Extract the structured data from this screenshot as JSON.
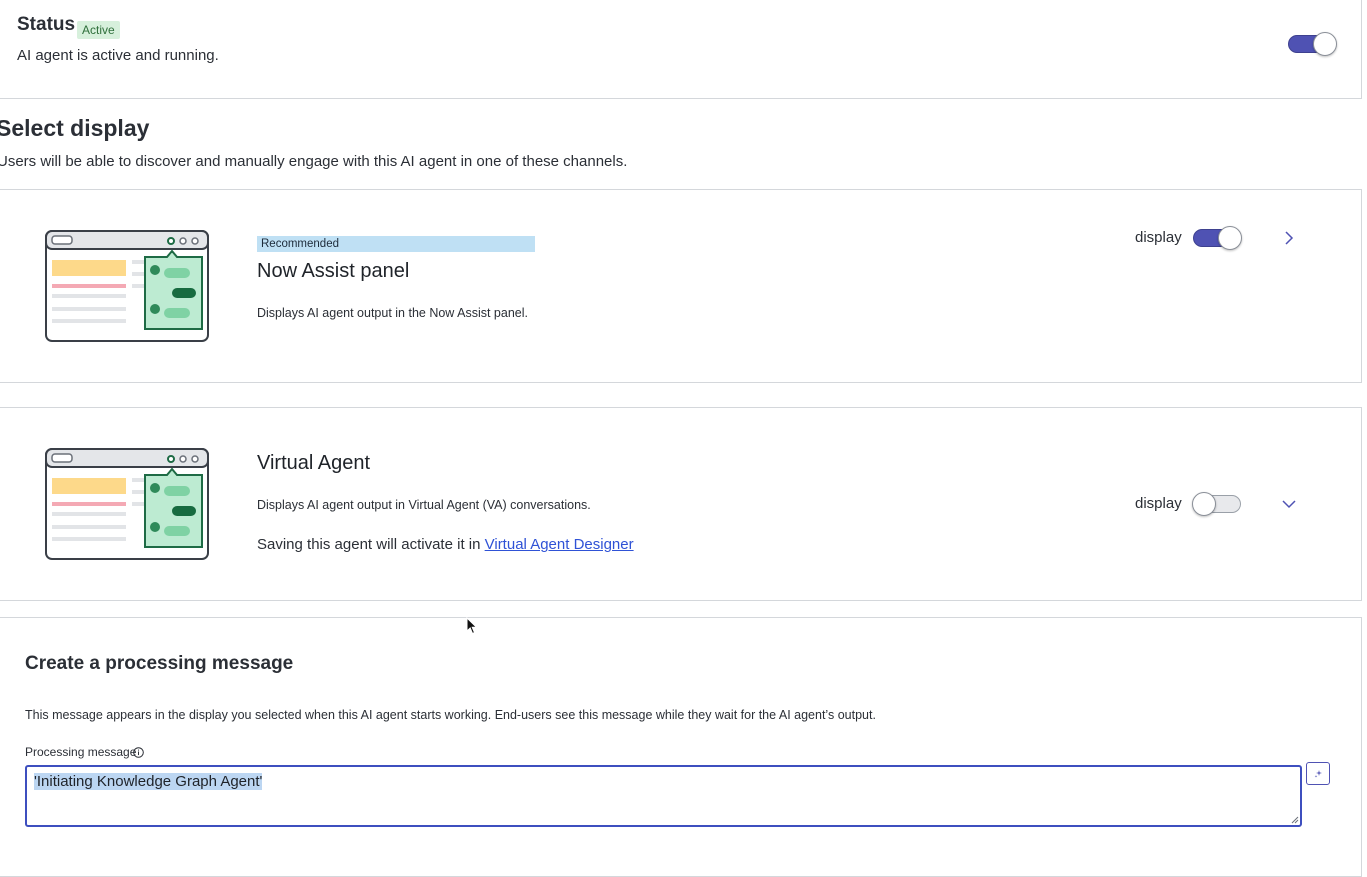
{
  "status": {
    "title": "Status",
    "badge": "Active",
    "description": "AI agent is active and running.",
    "toggle_on": true
  },
  "display_section": {
    "title": "Select display",
    "subtitle": "Users will be able to discover and manually engage with this AI agent in one of these channels."
  },
  "channels": [
    {
      "badge": "Recommended",
      "title": "Now Assist panel",
      "description": "Displays AI agent output in the Now Assist panel.",
      "toggle_label": "display",
      "toggle_on": true,
      "chevron": "chevron-right-icon"
    },
    {
      "title": "Virtual Agent",
      "description": "Displays AI agent output in Virtual Agent (VA) conversations.",
      "save_note": "Saving this agent will activate it in ",
      "link_text": "Virtual Agent Designer",
      "toggle_label": "display",
      "toggle_on": false,
      "chevron": "chevron-down-icon"
    }
  ],
  "processing": {
    "title": "Create a processing message",
    "description": "This message appears in the display you selected when this AI agent starts working. End-users see this message while they wait for the AI agent’s output.",
    "label": "Processing message",
    "value": "'Initiating Knowledge Graph Agent'"
  },
  "colors": {
    "accent": "#4f52b3",
    "badge_active_bg": "#d7f0dc",
    "badge_recommended_bg": "#bfe0f4",
    "link": "#2f52d6"
  }
}
